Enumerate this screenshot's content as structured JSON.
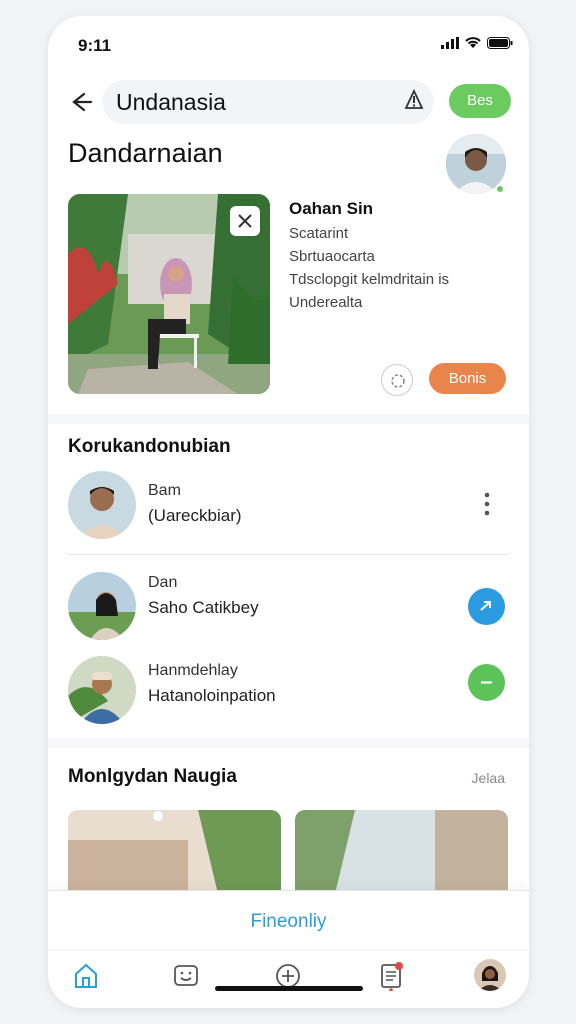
{
  "status": {
    "time": "9:11"
  },
  "search": {
    "query": "Undanasia"
  },
  "header": {
    "badge": "Bes",
    "title": "Dandarnaian"
  },
  "card": {
    "name": "Oahan Sin",
    "lines": [
      "Scatarint",
      "Sbrtuaocarta",
      "Tdsclopgit kelmdritain is",
      "Underealta"
    ],
    "action": "Bonis"
  },
  "section1": {
    "title": "Korukandonubian"
  },
  "contacts": [
    {
      "name": "Bam",
      "sub": "(Uareckbiar)",
      "action": "more"
    },
    {
      "name": "Dan",
      "sub": "Saho Catikbey",
      "action": "blue",
      "icon_color": "#2b9be0"
    },
    {
      "name": "Hanmdehlay",
      "sub": "Hatanoloinpation",
      "action": "green",
      "icon_color": "#5cc35a"
    }
  ],
  "section2": {
    "title": "Monlgydan Naugia",
    "meta": "Jelaa"
  },
  "footer": {
    "label": "Fineonliy"
  },
  "colors": {
    "green": "#6ccb5f",
    "orange": "#e9854a",
    "blue": "#2b9be0",
    "accent": "#2a9fd8"
  },
  "nav_icons": [
    "home-icon",
    "chat-icon",
    "add-icon",
    "notes-icon",
    "profile-avatar"
  ]
}
